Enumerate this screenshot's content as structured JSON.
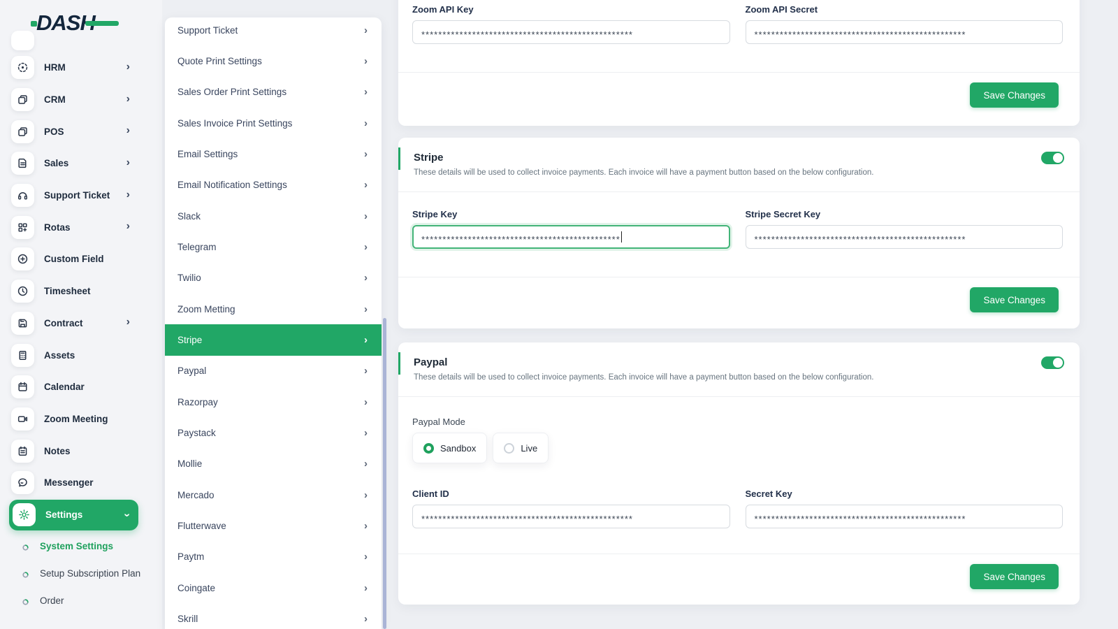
{
  "logo": {
    "text": "DASH"
  },
  "colors": {
    "accent": "#21a766",
    "scrollbar_thumb": "#aab4d6"
  },
  "sidebar": {
    "items": [
      {
        "label": "HRM",
        "icon": "hrm",
        "chevron": true
      },
      {
        "label": "CRM",
        "icon": "crm",
        "chevron": true
      },
      {
        "label": "POS",
        "icon": "pos",
        "chevron": true
      },
      {
        "label": "Sales",
        "icon": "sales",
        "chevron": true
      },
      {
        "label": "Support Ticket",
        "icon": "support-ticket",
        "chevron": true
      },
      {
        "label": "Rotas",
        "icon": "rotas",
        "chevron": true
      },
      {
        "label": "Custom Field",
        "icon": "custom-field",
        "chevron": false
      },
      {
        "label": "Timesheet",
        "icon": "timesheet",
        "chevron": false
      },
      {
        "label": "Contract",
        "icon": "contract",
        "chevron": true
      },
      {
        "label": "Assets",
        "icon": "assets",
        "chevron": false
      },
      {
        "label": "Calendar",
        "icon": "calendar",
        "chevron": false
      },
      {
        "label": "Zoom Meeting",
        "icon": "zoom-meeting",
        "chevron": false
      },
      {
        "label": "Notes",
        "icon": "notes",
        "chevron": false
      },
      {
        "label": "Messenger",
        "icon": "messenger",
        "chevron": false
      },
      {
        "label": "Settings",
        "icon": "settings",
        "chevron": "down",
        "active": true
      }
    ],
    "sub_items": [
      {
        "label": "System Settings",
        "active": true
      },
      {
        "label": "Setup Subscription Plan",
        "active": false
      },
      {
        "label": "Order",
        "active": false
      }
    ]
  },
  "settings_menu": {
    "items": [
      {
        "label": "Support Ticket"
      },
      {
        "label": "Quote Print Settings"
      },
      {
        "label": "Sales Order Print Settings"
      },
      {
        "label": "Sales Invoice Print Settings"
      },
      {
        "label": "Email Settings"
      },
      {
        "label": "Email Notification Settings"
      },
      {
        "label": "Slack"
      },
      {
        "label": "Telegram"
      },
      {
        "label": "Twilio"
      },
      {
        "label": "Zoom Metting"
      },
      {
        "label": "Stripe",
        "active": true
      },
      {
        "label": "Paypal"
      },
      {
        "label": "Razorpay"
      },
      {
        "label": "Paystack"
      },
      {
        "label": "Mollie"
      },
      {
        "label": "Mercado"
      },
      {
        "label": "Flutterwave"
      },
      {
        "label": "Paytm"
      },
      {
        "label": "Coingate"
      },
      {
        "label": "Skrill"
      }
    ]
  },
  "main": {
    "zoom_card": {
      "fields": [
        {
          "label": "Zoom API Key",
          "value": "**************************************************"
        },
        {
          "label": "Zoom API Secret",
          "value": "**************************************************"
        }
      ],
      "save_label": "Save Changes"
    },
    "stripe_card": {
      "title": "Stripe",
      "description": "These details will be used to collect invoice payments. Each invoice will have a payment button based on the below configuration.",
      "toggle_on": true,
      "fields": [
        {
          "label": "Stripe Key",
          "value": "***********************************************",
          "focused": true
        },
        {
          "label": "Stripe Secret Key",
          "value": "**************************************************"
        }
      ],
      "save_label": "Save Changes"
    },
    "paypal_card": {
      "title": "Paypal",
      "description": "These details will be used to collect invoice payments. Each invoice will have a payment button based on the below configuration.",
      "toggle_on": true,
      "mode_label": "Paypal Mode",
      "modes": [
        {
          "label": "Sandbox",
          "selected": true
        },
        {
          "label": "Live",
          "selected": false
        }
      ],
      "fields": [
        {
          "label": "Client ID",
          "value": "**************************************************"
        },
        {
          "label": "Secret Key",
          "value": "**************************************************"
        }
      ],
      "save_label": "Save Changes"
    }
  }
}
